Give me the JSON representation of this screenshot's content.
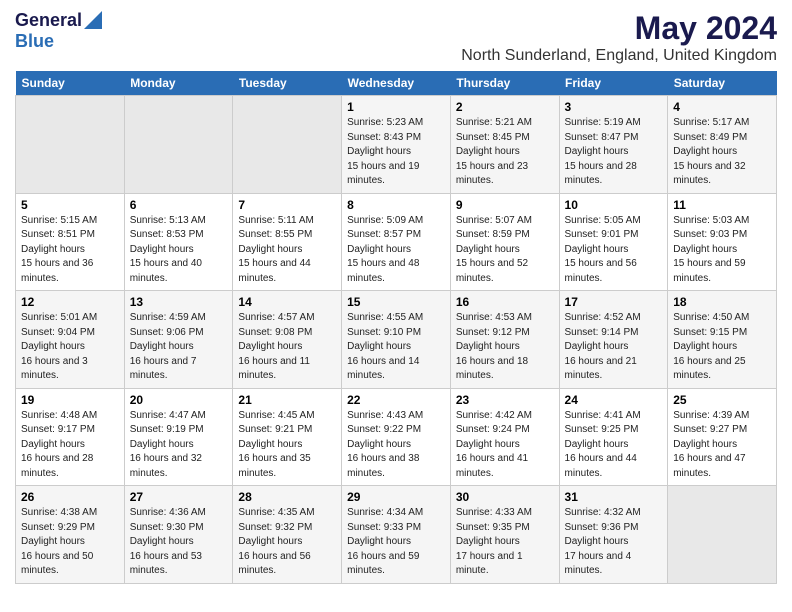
{
  "logo": {
    "general": "General",
    "blue": "Blue"
  },
  "title": {
    "month": "May 2024",
    "location": "North Sunderland, England, United Kingdom"
  },
  "headers": [
    "Sunday",
    "Monday",
    "Tuesday",
    "Wednesday",
    "Thursday",
    "Friday",
    "Saturday"
  ],
  "weeks": [
    [
      {
        "day": "",
        "empty": true
      },
      {
        "day": "",
        "empty": true
      },
      {
        "day": "",
        "empty": true
      },
      {
        "day": "1",
        "sunrise": "5:23 AM",
        "sunset": "8:43 PM",
        "daylight": "15 hours and 19 minutes."
      },
      {
        "day": "2",
        "sunrise": "5:21 AM",
        "sunset": "8:45 PM",
        "daylight": "15 hours and 23 minutes."
      },
      {
        "day": "3",
        "sunrise": "5:19 AM",
        "sunset": "8:47 PM",
        "daylight": "15 hours and 28 minutes."
      },
      {
        "day": "4",
        "sunrise": "5:17 AM",
        "sunset": "8:49 PM",
        "daylight": "15 hours and 32 minutes."
      }
    ],
    [
      {
        "day": "5",
        "sunrise": "5:15 AM",
        "sunset": "8:51 PM",
        "daylight": "15 hours and 36 minutes."
      },
      {
        "day": "6",
        "sunrise": "5:13 AM",
        "sunset": "8:53 PM",
        "daylight": "15 hours and 40 minutes."
      },
      {
        "day": "7",
        "sunrise": "5:11 AM",
        "sunset": "8:55 PM",
        "daylight": "15 hours and 44 minutes."
      },
      {
        "day": "8",
        "sunrise": "5:09 AM",
        "sunset": "8:57 PM",
        "daylight": "15 hours and 48 minutes."
      },
      {
        "day": "9",
        "sunrise": "5:07 AM",
        "sunset": "8:59 PM",
        "daylight": "15 hours and 52 minutes."
      },
      {
        "day": "10",
        "sunrise": "5:05 AM",
        "sunset": "9:01 PM",
        "daylight": "15 hours and 56 minutes."
      },
      {
        "day": "11",
        "sunrise": "5:03 AM",
        "sunset": "9:03 PM",
        "daylight": "15 hours and 59 minutes."
      }
    ],
    [
      {
        "day": "12",
        "sunrise": "5:01 AM",
        "sunset": "9:04 PM",
        "daylight": "16 hours and 3 minutes."
      },
      {
        "day": "13",
        "sunrise": "4:59 AM",
        "sunset": "9:06 PM",
        "daylight": "16 hours and 7 minutes."
      },
      {
        "day": "14",
        "sunrise": "4:57 AM",
        "sunset": "9:08 PM",
        "daylight": "16 hours and 11 minutes."
      },
      {
        "day": "15",
        "sunrise": "4:55 AM",
        "sunset": "9:10 PM",
        "daylight": "16 hours and 14 minutes."
      },
      {
        "day": "16",
        "sunrise": "4:53 AM",
        "sunset": "9:12 PM",
        "daylight": "16 hours and 18 minutes."
      },
      {
        "day": "17",
        "sunrise": "4:52 AM",
        "sunset": "9:14 PM",
        "daylight": "16 hours and 21 minutes."
      },
      {
        "day": "18",
        "sunrise": "4:50 AM",
        "sunset": "9:15 PM",
        "daylight": "16 hours and 25 minutes."
      }
    ],
    [
      {
        "day": "19",
        "sunrise": "4:48 AM",
        "sunset": "9:17 PM",
        "daylight": "16 hours and 28 minutes."
      },
      {
        "day": "20",
        "sunrise": "4:47 AM",
        "sunset": "9:19 PM",
        "daylight": "16 hours and 32 minutes."
      },
      {
        "day": "21",
        "sunrise": "4:45 AM",
        "sunset": "9:21 PM",
        "daylight": "16 hours and 35 minutes."
      },
      {
        "day": "22",
        "sunrise": "4:43 AM",
        "sunset": "9:22 PM",
        "daylight": "16 hours and 38 minutes."
      },
      {
        "day": "23",
        "sunrise": "4:42 AM",
        "sunset": "9:24 PM",
        "daylight": "16 hours and 41 minutes."
      },
      {
        "day": "24",
        "sunrise": "4:41 AM",
        "sunset": "9:25 PM",
        "daylight": "16 hours and 44 minutes."
      },
      {
        "day": "25",
        "sunrise": "4:39 AM",
        "sunset": "9:27 PM",
        "daylight": "16 hours and 47 minutes."
      }
    ],
    [
      {
        "day": "26",
        "sunrise": "4:38 AM",
        "sunset": "9:29 PM",
        "daylight": "16 hours and 50 minutes."
      },
      {
        "day": "27",
        "sunrise": "4:36 AM",
        "sunset": "9:30 PM",
        "daylight": "16 hours and 53 minutes."
      },
      {
        "day": "28",
        "sunrise": "4:35 AM",
        "sunset": "9:32 PM",
        "daylight": "16 hours and 56 minutes."
      },
      {
        "day": "29",
        "sunrise": "4:34 AM",
        "sunset": "9:33 PM",
        "daylight": "16 hours and 59 minutes."
      },
      {
        "day": "30",
        "sunrise": "4:33 AM",
        "sunset": "9:35 PM",
        "daylight": "17 hours and 1 minute."
      },
      {
        "day": "31",
        "sunrise": "4:32 AM",
        "sunset": "9:36 PM",
        "daylight": "17 hours and 4 minutes."
      },
      {
        "day": "",
        "empty": true
      }
    ]
  ]
}
